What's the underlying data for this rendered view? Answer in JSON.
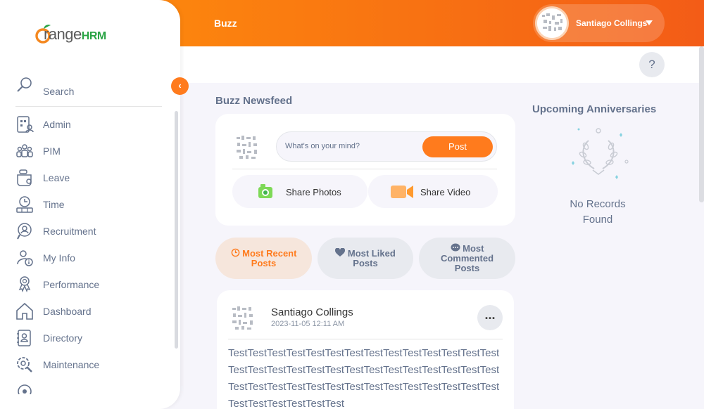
{
  "app": {
    "brand_main": "range",
    "brand_suffix": "HRM"
  },
  "header": {
    "title": "Buzz",
    "user_name": "Santiago Collings",
    "help_label": "?"
  },
  "sidebar": {
    "search_label": "Search",
    "collapse_glyph": "‹",
    "items": [
      {
        "label": "Admin",
        "icon": "admin-icon"
      },
      {
        "label": "PIM",
        "icon": "pim-icon"
      },
      {
        "label": "Leave",
        "icon": "leave-icon"
      },
      {
        "label": "Time",
        "icon": "time-icon"
      },
      {
        "label": "Recruitment",
        "icon": "recruitment-icon"
      },
      {
        "label": "My Info",
        "icon": "my-info-icon"
      },
      {
        "label": "Performance",
        "icon": "performance-icon"
      },
      {
        "label": "Dashboard",
        "icon": "dashboard-icon"
      },
      {
        "label": "Directory",
        "icon": "directory-icon"
      },
      {
        "label": "Maintenance",
        "icon": "maintenance-icon"
      }
    ]
  },
  "feed": {
    "title": "Buzz Newsfeed",
    "placeholder": "What's on your mind?",
    "post_label": "Post",
    "share_photos": "Share Photos",
    "share_video": "Share Video",
    "filters": {
      "recent": [
        "Most Recent",
        "Posts"
      ],
      "liked": [
        "Most Liked",
        "Posts"
      ],
      "commented": [
        "Most",
        "Commented",
        "Posts"
      ]
    },
    "post": {
      "author": "Santiago Collings",
      "date": "2023-11-05 12:11 AM",
      "more_label": "...",
      "body": "TestTestTestTestTestTestTestTestTestTestTestTestTestTestTestTestTestTestTestTestTestTestTestTestTestTestTestTestTestTestTestTestTestTestTestTestTestTestTestTestTestTestTestTestTestTestTestTest"
    }
  },
  "anniversaries": {
    "title": "Upcoming Anniversaries",
    "empty": [
      "No Records",
      "Found"
    ]
  },
  "colors": {
    "accent": "#ff7b1d",
    "header_start": "#ff920b",
    "header_end": "#f35c17",
    "brand_green": "#2aa445"
  }
}
